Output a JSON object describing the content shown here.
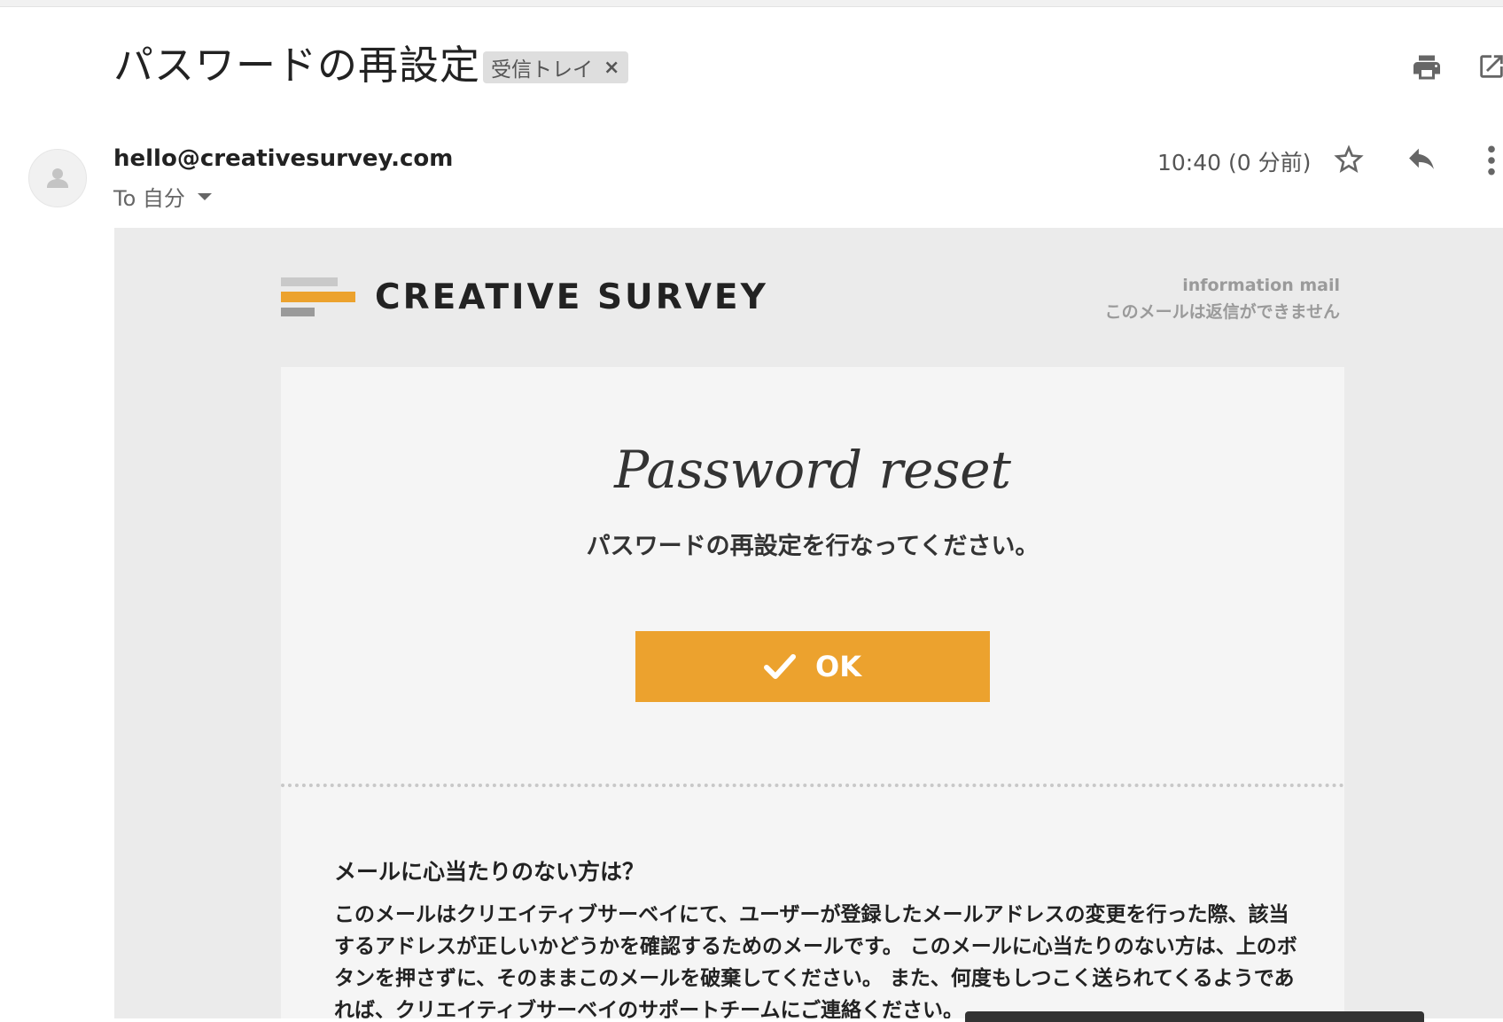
{
  "email": {
    "subject": "パスワードの再設定",
    "label": "受信トレイ",
    "label_remove": "×",
    "sender": "hello@creativesurvey.com",
    "to": "To 自分",
    "time": "10:40 (0 分前)"
  },
  "icons": {
    "print": "print-icon",
    "popout": "open-in-new-window-icon",
    "avatar": "person-avatar-icon",
    "star": "star-outline-icon",
    "reply": "reply-icon",
    "more": "more-vertical-icon",
    "caret": "caret-down-icon",
    "check": "checkmark-icon"
  },
  "mail_content": {
    "brand": "CREATIVE SURVEY",
    "info_line1": "information mail",
    "info_line2": "このメールは返信ができません",
    "title": "Password reset",
    "subtitle": "パスワードの再設定を行なってください。",
    "ok_button": "OK",
    "question_title": "メールに心当たりのない方は？",
    "question_body": "このメールはクリエイティブサーベイにて、ユーザーが登録したメールアドレスの変更を行った際、該当するアドレスが正しいかどうかを確認するためのメールです。 このメールに心当たりのない方は、上のボタンを押さずに、そのままこのメールを破棄してください。 また、何度もしつこく送られてくるようであれば、クリエイティブサーベイのサポートチームにご連絡ください。"
  },
  "colors": {
    "accent_orange": "#eca22e",
    "mail_background": "#ebebeb",
    "card_background": "#f5f5f5"
  }
}
